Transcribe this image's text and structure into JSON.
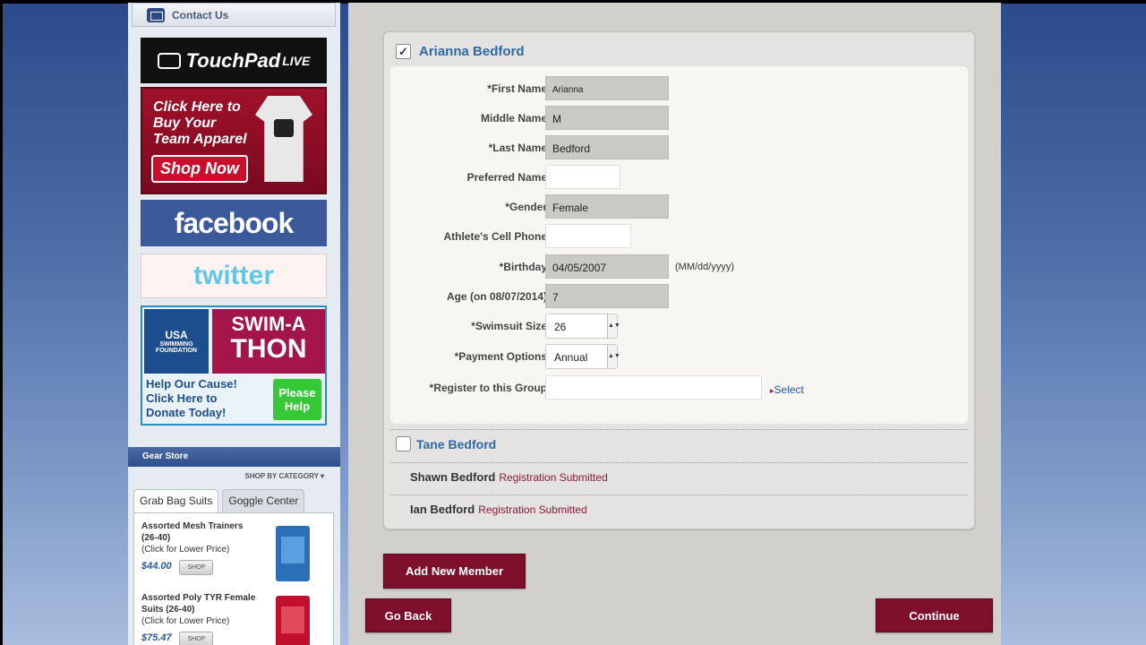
{
  "sidebar": {
    "contact_label": "Contact Us",
    "touchpad": {
      "name": "TouchPad",
      "suffix": "LIVE"
    },
    "shop_ad": {
      "line1": "Click Here to",
      "line2": "Buy Your",
      "line3": "Team Apparel",
      "cta": "Shop Now"
    },
    "facebook": "facebook",
    "twitter": "twitter",
    "swim_ad": {
      "org_line1": "USA",
      "org_line2": "SWIMMING FOUNDATION",
      "title_line1": "SWIM-A",
      "title_line2": "THON",
      "cause_line1": "Help Our Cause!",
      "cause_line2": "Click Here to",
      "cause_line3": "Donate Today!",
      "help_line1": "Please",
      "help_line2": "Help"
    },
    "gear_store": {
      "title": "Gear Store",
      "shop_by_category": "SHOP BY CATEGORY ▾",
      "tabs": [
        "Grab Bag Suits",
        "Goggle Center"
      ],
      "items": [
        {
          "name": "Assorted Mesh Trainers",
          "size": "(26-40)",
          "note": "(Click for Lower Price)",
          "price": "$44.00",
          "shop": "SHOP"
        },
        {
          "name": "Assorted Poly TYR Female",
          "size": "Suits (26-40)",
          "note": "(Click for Lower Price)",
          "price": "$75.47",
          "shop": "SHOP"
        }
      ]
    }
  },
  "member": {
    "name": "Arianna Bedford",
    "checked": "✓",
    "fields": {
      "first_name": {
        "label": "*First Name",
        "value": "Arianna"
      },
      "middle_name": {
        "label": "Middle Name",
        "value": "M"
      },
      "last_name": {
        "label": "*Last Name",
        "value": "Bedford"
      },
      "preferred_name": {
        "label": "Preferred Name",
        "value": ""
      },
      "gender": {
        "label": "*Gender",
        "value": "Female"
      },
      "cell_phone": {
        "label": "Athlete's Cell Phone",
        "value": ""
      },
      "birthday": {
        "label": "*Birthday",
        "value": "04/05/2007",
        "hint": "(MM/dd/yyyy)"
      },
      "age": {
        "label": "Age (on 08/07/2014)",
        "value": "7"
      },
      "swimsuit_size": {
        "label": "*Swimsuit Size",
        "value": "26"
      },
      "payment_options": {
        "label": "*Payment Options",
        "value": "Annual"
      },
      "group": {
        "label": "*Register to this Group",
        "value": "",
        "select_link": "Select"
      }
    }
  },
  "other_members": [
    {
      "name": "Tane Bedford"
    },
    {
      "name": "Shawn Bedford",
      "status": "Registration Submitted"
    },
    {
      "name": "Ian Bedford",
      "status": "Registration Submitted"
    }
  ],
  "buttons": {
    "add_member": "Add New Member",
    "go_back": "Go Back",
    "continue": "Continue"
  },
  "colors": {
    "accent_button": "#7d0f2b",
    "link_blue": "#2f6aa6",
    "status_red": "#8a1a3a"
  }
}
